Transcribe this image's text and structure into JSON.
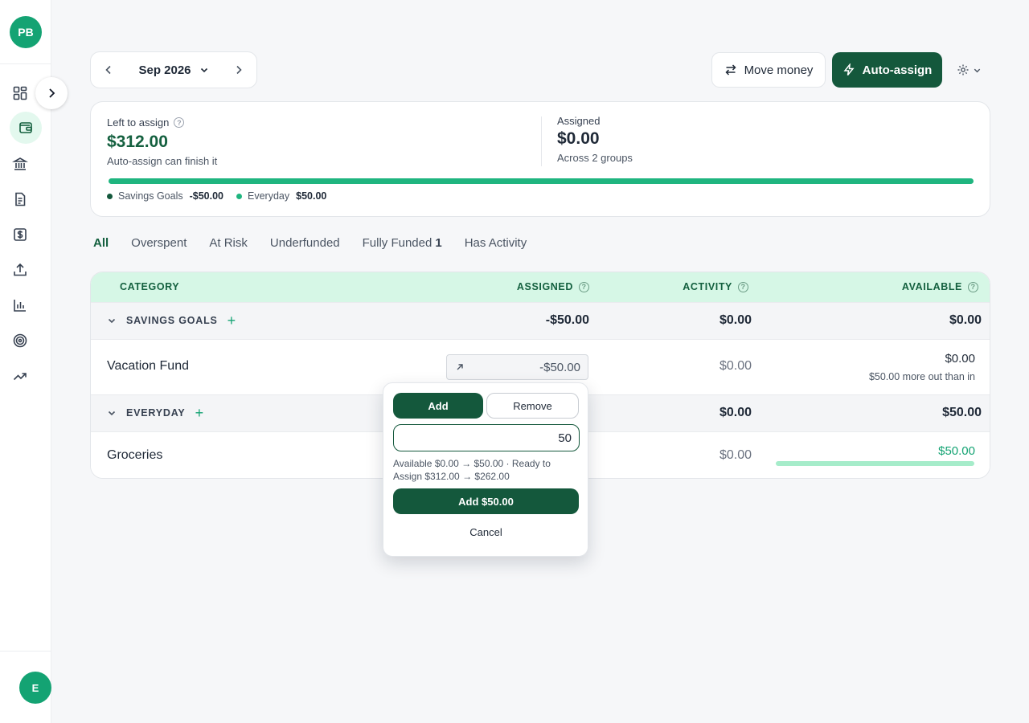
{
  "user": {
    "initials": "PB",
    "bottom_initials": "E"
  },
  "nav": {
    "items": [
      "dashboard-icon",
      "budget-wallet-icon",
      "bank-icon",
      "document-icon",
      "dollar-icon",
      "upload-icon",
      "bar-chart-icon",
      "target-icon",
      "trend-icon"
    ],
    "active": "budget-wallet-icon"
  },
  "topbar": {
    "month": "Sep 2026",
    "move_money": "Move money",
    "auto_assign": "Auto-assign"
  },
  "summary": {
    "left_label": "Left to assign",
    "left_amount": "$312.00",
    "left_sub": "Auto-assign can finish it",
    "assigned_label": "Assigned",
    "assigned_amount": "$0.00",
    "assigned_sub": "Across 2 groups",
    "progress_fraction": 1.0,
    "legend": [
      {
        "name": "Savings Goals",
        "value": "-$50.00",
        "color": "#14583c"
      },
      {
        "name": "Everyday",
        "value": "$50.00",
        "color": "#1fb57f"
      }
    ]
  },
  "tabs": {
    "all": "All",
    "overspent": "Overspent",
    "at_risk": "At Risk",
    "underfunded": "Underfunded",
    "fully_funded": "Fully Funded",
    "fully_funded_count": "1",
    "has_activity": "Has Activity"
  },
  "table": {
    "headers": {
      "category": "CATEGORY",
      "assigned": "ASSIGNED",
      "activity": "ACTIVITY",
      "available": "AVAILABLE"
    },
    "groups": [
      {
        "name": "SAVINGS GOALS",
        "assigned": "-$50.00",
        "activity": "$0.00",
        "available": "$0.00",
        "categories": [
          {
            "name": "Vacation Fund",
            "assigned": "-$50.00",
            "activity": "$0.00",
            "available": "$0.00",
            "note": "$50.00 more out than in"
          }
        ]
      },
      {
        "name": "EVERYDAY",
        "activity": "$0.00",
        "available": "$50.00",
        "categories": [
          {
            "name": "Groceries",
            "activity": "$0.00",
            "available": "$50.00",
            "funded_fraction": 1.0
          }
        ]
      }
    ]
  },
  "popover": {
    "add_tab": "Add",
    "remove_tab": "Remove",
    "amount_value": "50",
    "preview_text": "Available $0.00 → $50.00 · Ready to Assign $312.00 → $262.00",
    "confirm_label": "Add $50.00",
    "cancel_label": "Cancel"
  },
  "colors": {
    "brand_dark": "#14583c",
    "brand": "#14a373",
    "accent_green": "#1fb57f",
    "header_bg": "#d6f7e6"
  }
}
